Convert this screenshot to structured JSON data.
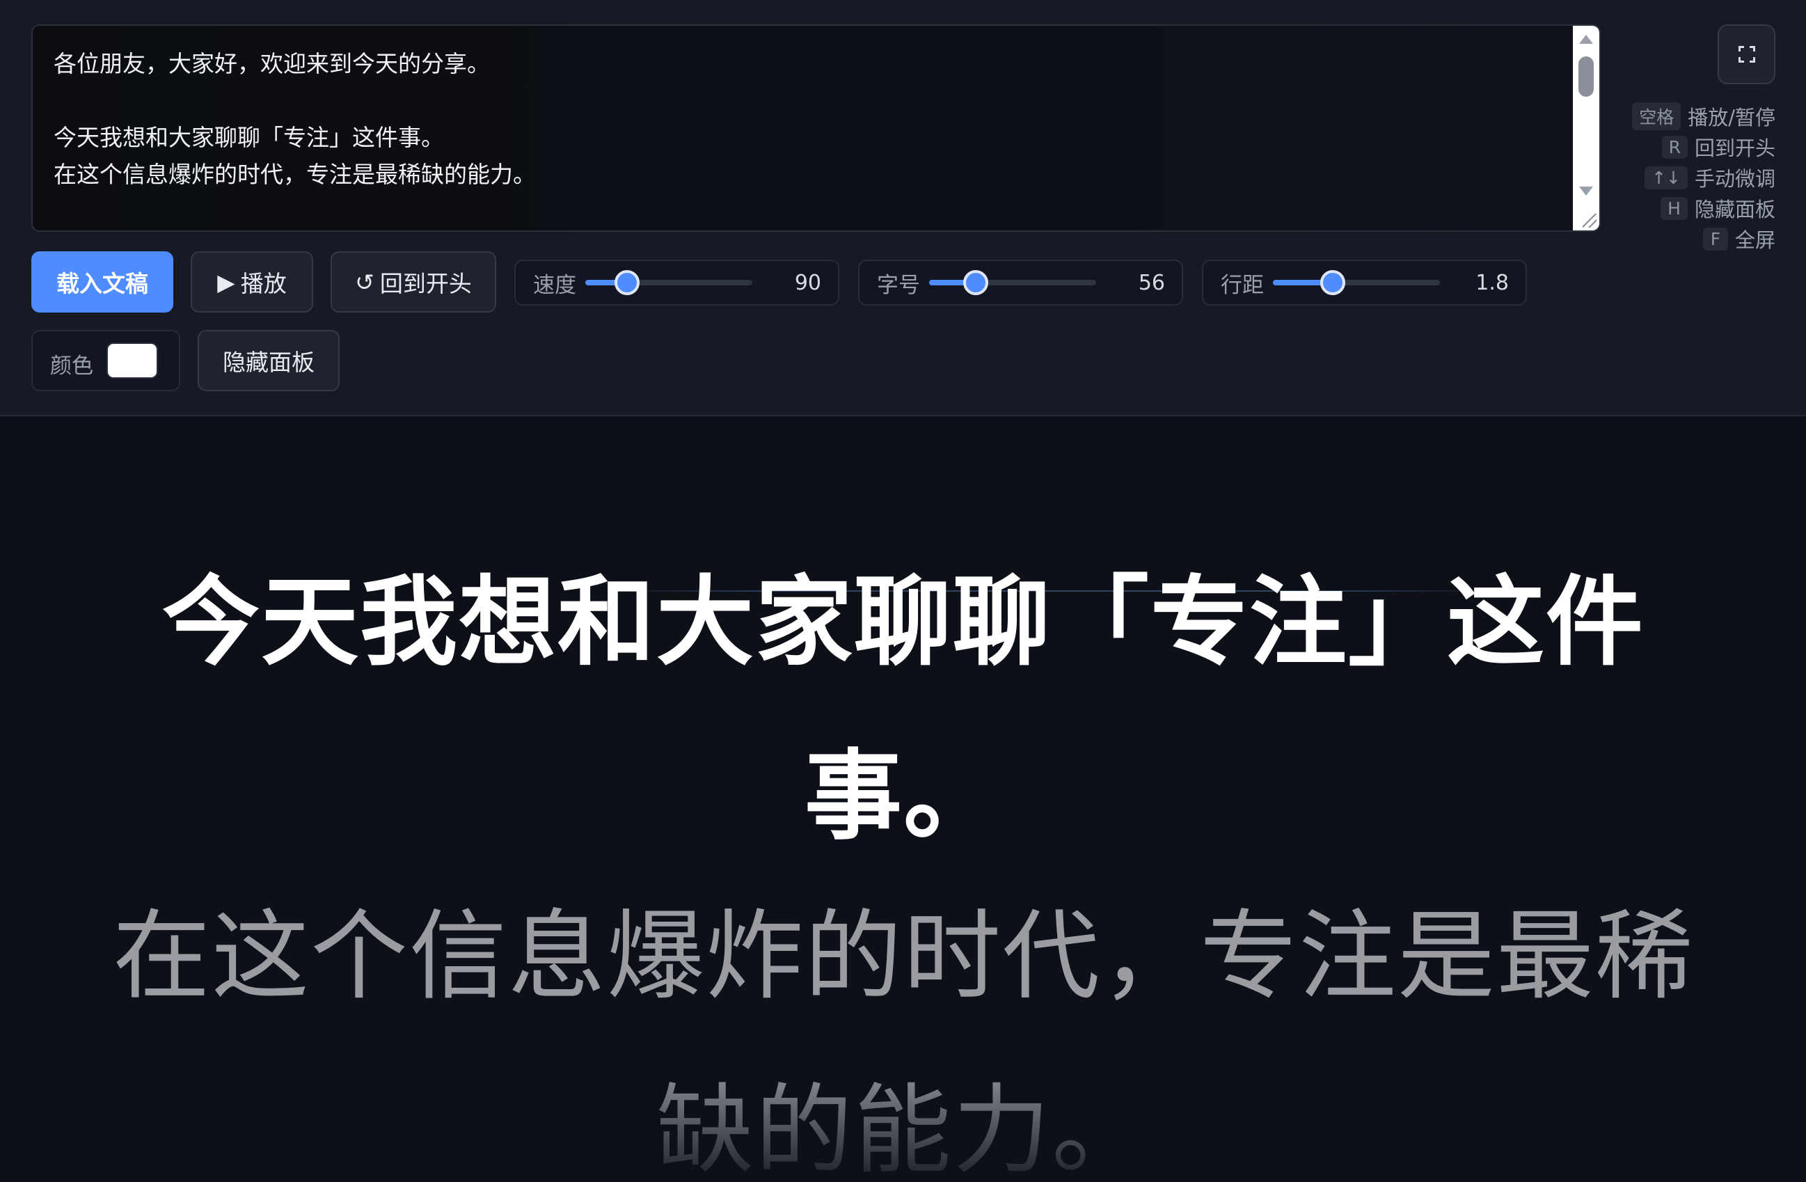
{
  "script": {
    "text": "各位朋友，大家好，欢迎来到今天的分享。\n\n今天我想和大家聊聊「专注」这件事。\n在这个信息爆炸的时代，专注是最稀缺的能力。"
  },
  "toolbar": {
    "load_label": "载入文稿",
    "play_icon": "▶",
    "play_label": "播放",
    "reset_icon": "↺",
    "reset_label": "回到开头",
    "hide_panel_label": "隐藏面板"
  },
  "sliders": {
    "speed": {
      "label": "速度",
      "value": "90",
      "fraction": 0.25
    },
    "font_size": {
      "label": "字号",
      "value": "56",
      "fraction": 0.28
    },
    "line_height": {
      "label": "行距",
      "value": "1.8",
      "fraction": 0.36
    }
  },
  "color": {
    "label": "颜色",
    "value": "#ffffff"
  },
  "shortcuts": [
    {
      "key": "空格",
      "action": "播放/暂停"
    },
    {
      "key": "R",
      "action": "回到开头"
    },
    {
      "key": "↑↓",
      "action": "手动微调"
    },
    {
      "key": "H",
      "action": "隐藏面板"
    },
    {
      "key": "F",
      "action": "全屏"
    }
  ],
  "prompter": {
    "active_line": "今天我想和大家聊聊「专注」这件事。",
    "next_line": "在这个信息爆炸的时代，专注是最稀缺的能力。"
  },
  "colors": {
    "accent": "#4f8cff",
    "background": "#0d1017",
    "panel": "#161a24"
  }
}
